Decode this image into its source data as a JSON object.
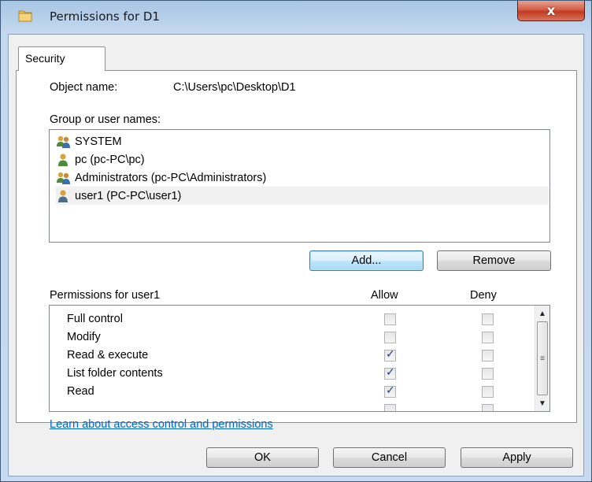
{
  "window": {
    "title": "Permissions for D1",
    "close_label": "x"
  },
  "tab": {
    "label": "Security"
  },
  "object": {
    "label": "Object name:",
    "value": "C:\\Users\\pc\\Desktop\\D1"
  },
  "groups": {
    "label": "Group or user names:",
    "items": [
      {
        "name": "SYSTEM",
        "icon": "group-users-icon",
        "selected": false
      },
      {
        "name": "pc (pc-PC\\pc)",
        "icon": "user-icon",
        "selected": false
      },
      {
        "name": "Administrators (pc-PC\\Administrators)",
        "icon": "group-users-icon",
        "selected": false
      },
      {
        "name": "user1 (PC-PC\\user1)",
        "icon": "user-icon",
        "selected": true
      }
    ]
  },
  "buttons": {
    "add": "Add...",
    "remove": "Remove",
    "ok": "OK",
    "cancel": "Cancel",
    "apply": "Apply"
  },
  "permissions": {
    "label": "Permissions for user1",
    "allow_header": "Allow",
    "deny_header": "Deny",
    "rows": [
      {
        "name": "Full control",
        "allow": false,
        "deny": false
      },
      {
        "name": "Modify",
        "allow": false,
        "deny": false
      },
      {
        "name": "Read & execute",
        "allow": true,
        "deny": false
      },
      {
        "name": "List folder contents",
        "allow": true,
        "deny": false
      },
      {
        "name": "Read",
        "allow": true,
        "deny": false
      }
    ]
  },
  "learn_link": "Learn about access control and permissions",
  "colors": {
    "link": "#0066cc",
    "check": "#20418a",
    "titlebar": "#c3d8ef",
    "close": "#c33b22"
  }
}
